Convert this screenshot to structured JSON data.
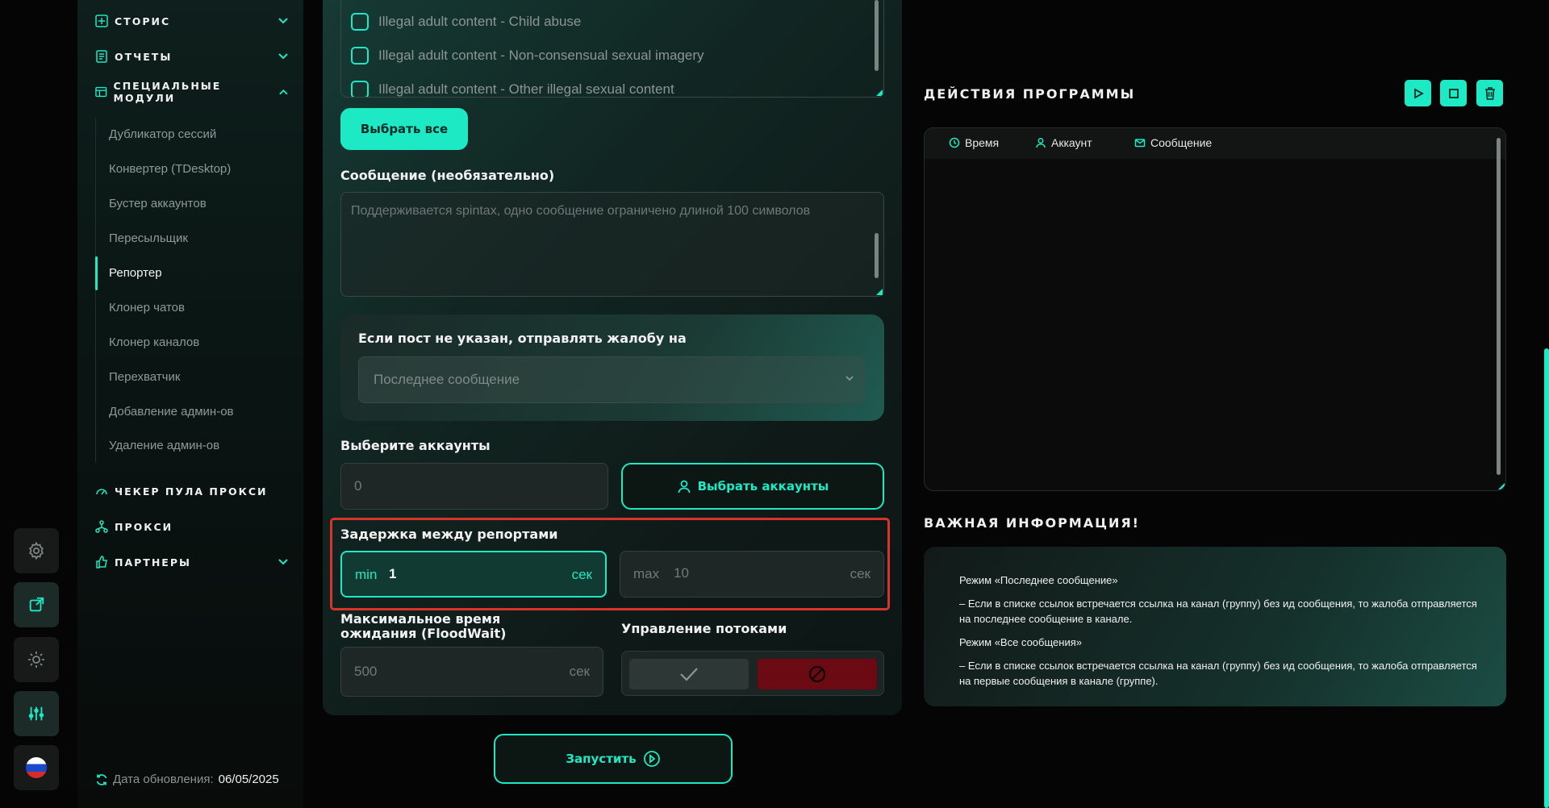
{
  "rail": {
    "icons": [
      "gear-icon",
      "external-link-icon",
      "sun-icon",
      "sliders-icon",
      "russia-flag-icon"
    ]
  },
  "sidebar": {
    "sections": {
      "stories": "СТОРИС",
      "reports": "ОТЧЕТЫ",
      "special": "СПЕЦИАЛЬНЫЕ МОДУЛИ",
      "proxy_checker": "ЧЕКЕР ПУЛА ПРОКСИ",
      "proxy": "ПРОКСИ",
      "partners": "ПАРТНЕРЫ"
    },
    "items": [
      "Дубликатор сессий",
      "Конвертер (TDesktop)",
      "Бустер аккаунтов",
      "Пересыльщик",
      "Репортер",
      "Клонер чатов",
      "Клонер каналов",
      "Перехватчик",
      "Добавление админ-ов",
      "Удаление админ-ов"
    ],
    "active_item": "Репортер",
    "update_label": "Дата обновления:",
    "update_date": "06/05/2025"
  },
  "reasons": {
    "options": [
      "Illegal adult content - Child abuse",
      "Illegal adult content - Non-consensual sexual imagery",
      "Illegal adult content - Other illegal sexual content"
    ],
    "select_all": "Выбрать все"
  },
  "message": {
    "label": "Сообщение (необязательно)",
    "placeholder": "Поддерживается spintax, одно сообщение ограничено длиной 100 символов"
  },
  "fallback": {
    "label": "Если пост не указан, отправлять жалобу на",
    "value": "Последнее сообщение"
  },
  "accounts": {
    "label": "Выберите аккаунты",
    "count": "0",
    "button": "Выбрать аккаунты"
  },
  "delay": {
    "label": "Задержка между репортами",
    "min_prefix": "min",
    "min_value": "1",
    "max_prefix": "max",
    "max_value": "10",
    "unit": "сек"
  },
  "floodwait": {
    "label": "Максимальное время ожидания (FloodWait)",
    "value": "500",
    "unit": "сек"
  },
  "threads": {
    "label": "Управление потоками"
  },
  "start_button": "Запустить",
  "log": {
    "title": "ДЕЙСТВИЯ ПРОГРАММЫ",
    "columns": {
      "time": "Время",
      "account": "Аккаунт",
      "message": "Сообщение"
    }
  },
  "info": {
    "title": "ВАЖНАЯ ИНФОРМАЦИЯ!",
    "lines": [
      "Режим «Последнее сообщение»",
      "– Если в списке ссылок встречается ссылка на канал (группу) без ид сообщения, то жалоба отправляется на последнее сообщение в канале.",
      "Режим «Все сообщения»",
      "– Если в списке ссылок встречается ссылка на канал (группу) без ид сообщения, то жалоба отправляется на первые сообщения в канале (группе)."
    ]
  },
  "colors": {
    "accent": "#1de9c4",
    "highlight": "#d9342b",
    "danger": "#6b0a12"
  }
}
